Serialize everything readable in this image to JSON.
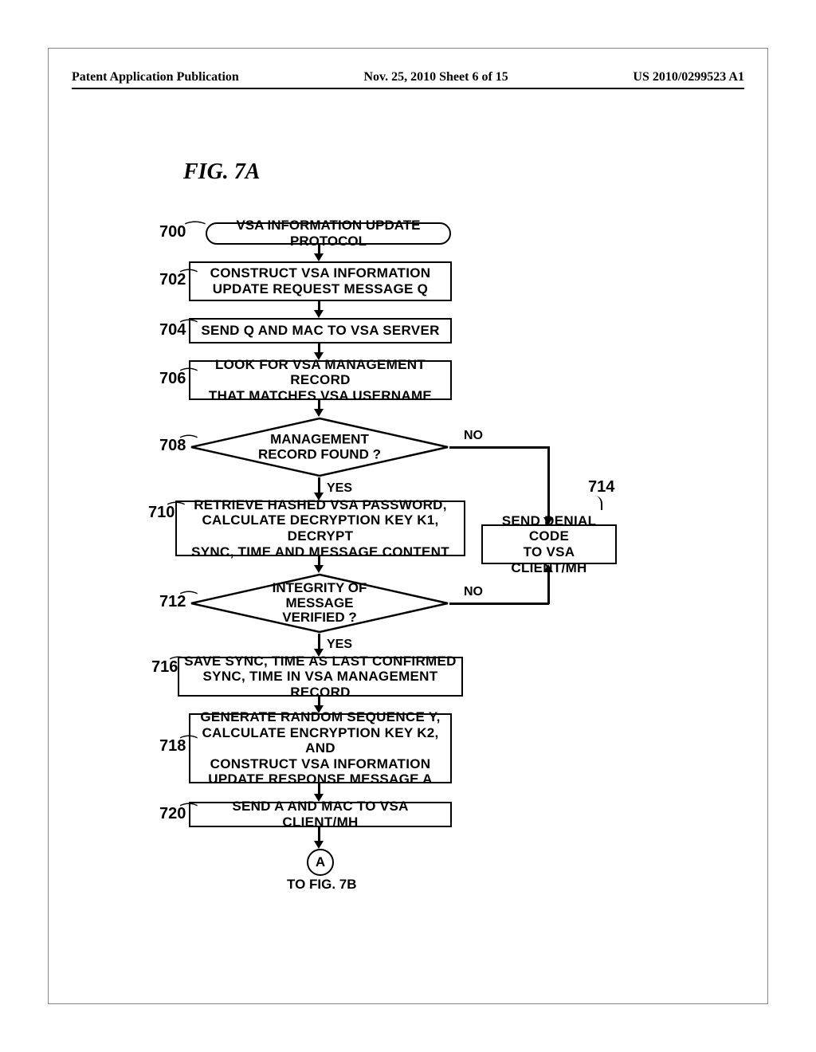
{
  "header": {
    "left": "Patent Application Publication",
    "center": "Nov. 25, 2010   Sheet 6 of 15",
    "right": "US 2010/0299523 A1"
  },
  "figure_title": "FIG.  7A",
  "refs": {
    "r700": "700",
    "r702": "702",
    "r704": "704",
    "r706": "706",
    "r708": "708",
    "r710": "710",
    "r712": "712",
    "r714": "714",
    "r716": "716",
    "r718": "718",
    "r720": "720"
  },
  "nodes": {
    "n700": "VSA INFORMATION UPDATE PROTOCOL",
    "n702": "CONSTRUCT VSA INFORMATION\nUPDATE REQUEST MESSAGE Q",
    "n704": "SEND Q AND MAC TO VSA SERVER",
    "n706": "LOOK FOR VSA MANAGEMENT RECORD\nTHAT MATCHES VSA USERNAME",
    "n708": "MANAGEMENT\nRECORD FOUND ?",
    "n710": "RETRIEVE HASHED VSA PASSWORD,\nCALCULATE DECRYPTION KEY K1, DECRYPT\nSYNC, TIME AND MESSAGE CONTENT",
    "n712": "INTEGRITY OF\nMESSAGE VERIFIED ?",
    "n714": "SEND DENIAL CODE\nTO VSA CLIENT/MH",
    "n716": "SAVE SYNC, TIME AS LAST CONFIRMED\nSYNC, TIME IN VSA MANAGEMENT RECORD",
    "n718": "GENERATE RANDOM SEQUENCE Y,\nCALCULATE ENCRYPTION KEY K2, AND\nCONSTRUCT VSA INFORMATION\nUPDATE RESPONSE MESSAGE A",
    "n720": "SEND A AND MAC TO VSA CLIENT/MH"
  },
  "labels": {
    "yes": "YES",
    "no": "NO"
  },
  "connector": {
    "letter": "A",
    "caption": "TO FIG. 7B"
  }
}
